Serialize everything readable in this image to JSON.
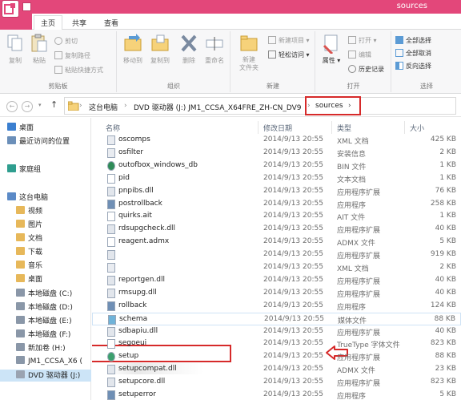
{
  "window": {
    "title": "sources",
    "accent": "#e3477a"
  },
  "tabs": [
    {
      "label": "主页"
    },
    {
      "label": "共享"
    },
    {
      "label": "查看"
    }
  ],
  "ribbon": {
    "clipboard": {
      "copy": "复制",
      "paste": "粘贴",
      "cut": "剪切",
      "copy_path": "复制路径",
      "paste_shortcut": "粘贴快捷方式",
      "label": "剪贴板"
    },
    "organize": {
      "move_to": "移动到",
      "copy_to": "复制到",
      "delete": "删除",
      "rename": "重命名",
      "label": "组织"
    },
    "new": {
      "new_folder": "新建\n文件夹",
      "new_item": "新建项目",
      "easy_access": "轻松访问",
      "label": "新建"
    },
    "open": {
      "properties": "属性",
      "open": "打开",
      "edit": "编辑",
      "history": "历史记录",
      "label": "打开"
    },
    "select": {
      "select_all": "全部选择",
      "select_none": "全部取消",
      "invert": "反向选择",
      "label": "选择"
    }
  },
  "address": {
    "crumbs": [
      "这台电脑",
      "DVD 驱动器 (J:) JM1_CCSA_X64FRE_ZH-CN_DV9",
      "sources"
    ],
    "highlight_color": "#d62a2a"
  },
  "nav_pane": [
    {
      "label": "桌面",
      "icon": "desktop-icon"
    },
    {
      "label": "最近访问的位置",
      "icon": "recent-icon"
    },
    {
      "label": "家庭组",
      "icon": "homegroup-icon"
    },
    {
      "label": "这台电脑",
      "icon": "computer-icon"
    },
    {
      "label": "视频",
      "icon": "video-folder-icon"
    },
    {
      "label": "图片",
      "icon": "pictures-folder-icon"
    },
    {
      "label": "文档",
      "icon": "documents-folder-icon"
    },
    {
      "label": "下载",
      "icon": "downloads-folder-icon"
    },
    {
      "label": "音乐",
      "icon": "music-folder-icon"
    },
    {
      "label": "桌面",
      "icon": "desktop-folder-icon"
    },
    {
      "label": "本地磁盘 (C:)",
      "icon": "drive-icon"
    },
    {
      "label": "本地磁盘 (D:)",
      "icon": "drive-icon"
    },
    {
      "label": "本地磁盘 (E:)",
      "icon": "drive-icon"
    },
    {
      "label": "本地磁盘 (F:)",
      "icon": "drive-icon"
    },
    {
      "label": "新加卷 (H:)",
      "icon": "drive-icon"
    },
    {
      "label": "JM1_CCSA_X6 (",
      "icon": "drive-icon"
    },
    {
      "label": "DVD 驱动器 (J:)",
      "icon": "dvd-icon"
    }
  ],
  "columns": {
    "name": "名称",
    "date": "修改日期",
    "type": "类型",
    "size": "大小"
  },
  "files": [
    {
      "name": "oscomps",
      "date": "2014/9/13 20:55",
      "type": "XML 文档",
      "size": "425 KB",
      "icon": "xml-file-icon"
    },
    {
      "name": "osfilter",
      "date": "2014/9/13 20:55",
      "type": "安装信息",
      "size": "2 KB",
      "icon": "inf-file-icon"
    },
    {
      "name": "outofbox_windows_db",
      "date": "2014/9/13 20:55",
      "type": "BIN 文件",
      "size": "1 KB",
      "icon": "bin-file-icon"
    },
    {
      "name": "pid",
      "date": "2014/9/13 20:55",
      "type": "文本文档",
      "size": "1 KB",
      "icon": "text-file-icon"
    },
    {
      "name": "pnpibs.dll",
      "date": "2014/9/13 20:55",
      "type": "应用程序扩展",
      "size": "76 KB",
      "icon": "dll-file-icon"
    },
    {
      "name": "postrollback",
      "date": "2014/9/13 20:55",
      "type": "应用程序",
      "size": "258 KB",
      "icon": "exe-file-icon"
    },
    {
      "name": "quirks.ait",
      "date": "2014/9/13 20:55",
      "type": "AIT 文件",
      "size": "1 KB",
      "icon": "file-icon"
    },
    {
      "name": "rdsupgcheck.dll",
      "date": "2014/9/13 20:55",
      "type": "应用程序扩展",
      "size": "40 KB",
      "icon": "dll-file-icon"
    },
    {
      "name": "reagent.admx",
      "date": "2014/9/13 20:55",
      "type": "ADMX 文件",
      "size": "5 KB",
      "icon": "file-icon"
    },
    {
      "name": "",
      "date": "2014/9/13 20:55",
      "type": "应用程序扩展",
      "size": "919 KB",
      "icon": "dll-file-icon"
    },
    {
      "name": "",
      "date": "2014/9/13 20:55",
      "type": "XML 文档",
      "size": "2 KB",
      "icon": "xml-file-icon"
    },
    {
      "name": "reportgen.dll",
      "date": "2014/9/13 20:55",
      "type": "应用程序扩展",
      "size": "40 KB",
      "icon": "dll-file-icon"
    },
    {
      "name": "rmsupg.dll",
      "date": "2014/9/13 20:55",
      "type": "应用程序扩展",
      "size": "40 KB",
      "icon": "dll-file-icon"
    },
    {
      "name": "rollback",
      "date": "2014/9/13 20:55",
      "type": "应用程序",
      "size": "124 KB",
      "icon": "exe-file-icon"
    },
    {
      "name": "schema",
      "date": "2014/9/13 20:55",
      "type": "媒体文件",
      "size": "88 KB",
      "icon": "media-file-icon"
    },
    {
      "name": "sdbapiu.dll",
      "date": "2014/9/13 20:55",
      "type": "应用程序扩展",
      "size": "40 KB",
      "icon": "dll-file-icon"
    },
    {
      "name": "segoeui",
      "date": "2014/9/13 20:55",
      "type": "TrueType 字体文件",
      "size": "823 KB",
      "icon": "font-file-icon"
    },
    {
      "name": "setup",
      "date": "2014/9/13 20:55",
      "type": "应用程序扩展",
      "size": "88 KB",
      "icon": "setup-exe-icon"
    },
    {
      "name": "setupcompat.dll",
      "date": "2014/9/13 20:55",
      "type": "ADMX 文件",
      "size": "23 KB",
      "icon": "dll-file-icon"
    },
    {
      "name": "setupcore.dll",
      "date": "2014/9/13 20:55",
      "type": "应用程序扩展",
      "size": "823 KB",
      "icon": "dll-file-icon"
    },
    {
      "name": "setuperror",
      "date": "2014/9/13 20:55",
      "type": "应用程序",
      "size": "5 KB",
      "icon": "exe-file-icon"
    }
  ]
}
